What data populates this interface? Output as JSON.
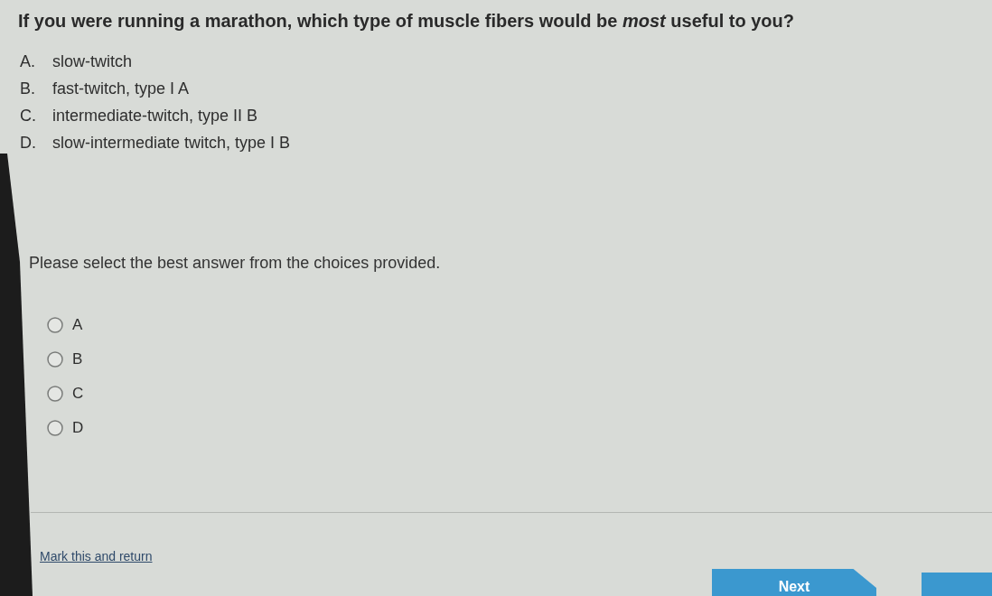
{
  "question": "If you were running a marathon, which type of muscle fibers would be *most* useful to you?",
  "options": [
    {
      "letter": "A.",
      "text": "slow-twitch"
    },
    {
      "letter": "B.",
      "text": "fast-twitch, type I A"
    },
    {
      "letter": "C.",
      "text": "intermediate-twitch, type II B"
    },
    {
      "letter": "D.",
      "text": "slow-intermediate twitch, type I B"
    }
  ],
  "instruction": "Please select the best answer from the choices provided.",
  "choices": [
    {
      "label": "A",
      "selected": false
    },
    {
      "label": "B",
      "selected": false
    },
    {
      "label": "C",
      "selected": false
    },
    {
      "label": "D",
      "selected": false
    }
  ],
  "footer": {
    "mark_link": "Mark this and return",
    "next_button": "Next"
  }
}
